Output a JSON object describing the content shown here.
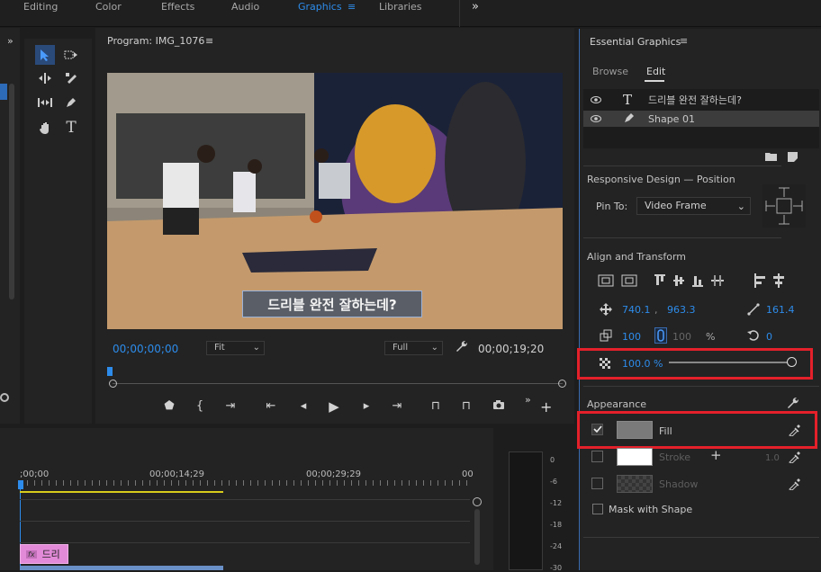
{
  "workspaces": [
    {
      "label": "Editing"
    },
    {
      "label": "Color"
    },
    {
      "label": "Effects"
    },
    {
      "label": "Audio"
    },
    {
      "label": "Graphics"
    },
    {
      "label": "Libraries"
    }
  ],
  "workspaces_more": "»",
  "panel_menu": "≡",
  "monitor": {
    "title": "Program: IMG_1076",
    "caption": "드리블 완전 잘하는데?",
    "timecode_current": "00;00;00;00",
    "fit_label": "Fit",
    "full_label": "Full",
    "timecode_duration": "00;00;19;20",
    "add_button": "+"
  },
  "essential_graphics": {
    "title": "Essential Graphics",
    "tab_browse": "Browse",
    "tab_edit": "Edit",
    "layers": [
      {
        "label": "드리블 완전 잘하는데?",
        "icon": "text-icon"
      },
      {
        "label": "Shape 01",
        "icon": "pen-icon"
      }
    ],
    "responsive_title": "Responsive Design — Position",
    "pin_to_label": "Pin To:",
    "pin_to_value": "Video Frame",
    "align_title": "Align and Transform",
    "pos_x": "740.1",
    "pos_y": "963.3",
    "rotation_value": "161.4",
    "scale": "100",
    "scale_locked": "100",
    "scale_unit": "%",
    "anchor_value": "0",
    "opacity_value": "100.0 %",
    "opacity_fraction": 1.0,
    "appearance_title": "Appearance",
    "fill_label": "Fill",
    "fill_color": "#7a7a7a",
    "stroke_label": "Stroke",
    "stroke_color": "#ffffff",
    "stroke_width": "1.0",
    "shadow_label": "Shadow",
    "mask_label": "Mask with Shape"
  },
  "timeline": {
    "times": [
      ";00;00",
      "00;00;14;29",
      "00;00;29;29",
      "00"
    ],
    "clip_label": "드리",
    "fx_badge": "fx"
  },
  "audio_meter": {
    "ticks": [
      "0",
      "-6",
      "-12",
      "-18",
      "-24",
      "-30"
    ]
  },
  "colors": {
    "accent": "#2d8ceb",
    "highlight_box": "#e4202a"
  }
}
